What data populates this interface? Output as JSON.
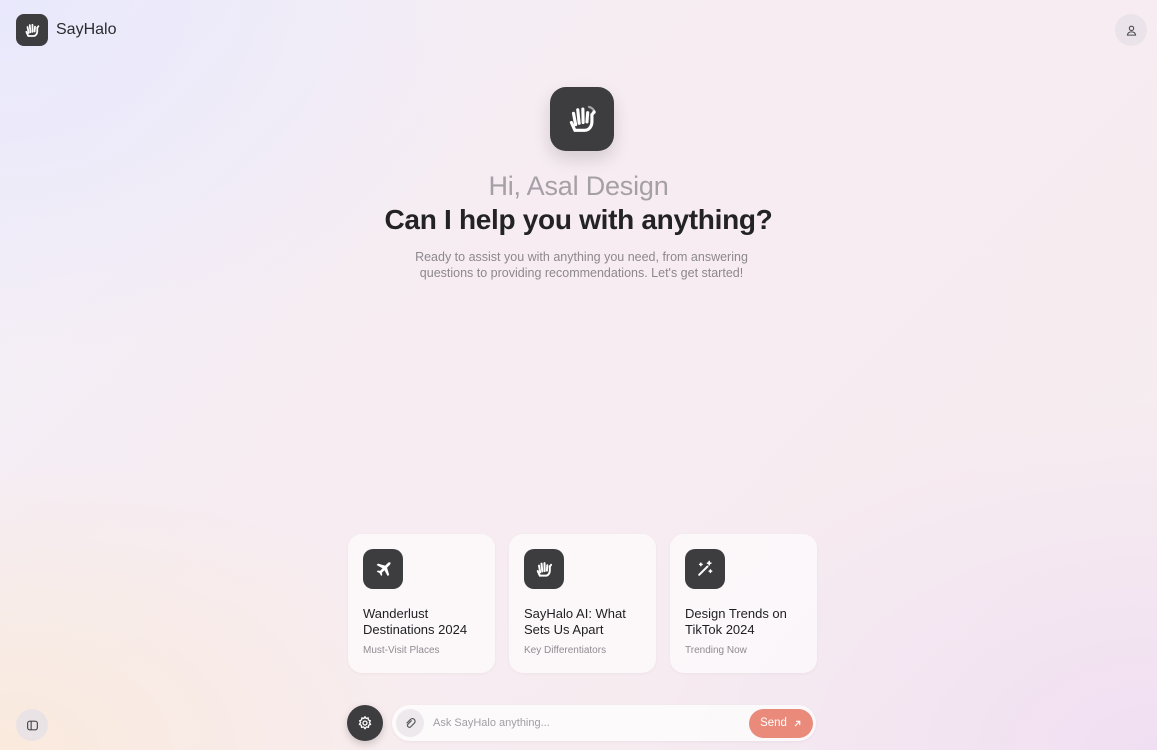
{
  "brand": {
    "name": "SayHalo",
    "logo_icon": "waving-hand-icon"
  },
  "header": {
    "profile_icon": "user-icon"
  },
  "hero": {
    "icon": "waving-hand-icon",
    "greeting": "Hi, Asal Design",
    "headline": "Can I help you with anything?",
    "subtitle": "Ready to assist you with anything you need, from answering questions to providing recommendations. Let's get started!"
  },
  "cards": [
    {
      "icon": "airplane-icon",
      "title": "Wanderlust Destinations 2024",
      "tag": "Must-Visit Places"
    },
    {
      "icon": "waving-hand-icon",
      "title": "SayHalo AI: What Sets Us Apart",
      "tag": "Key Differentiators"
    },
    {
      "icon": "magic-wand-icon",
      "title": "Design Trends on TikTok 2024",
      "tag": "Trending Now"
    }
  ],
  "composer": {
    "placeholder": "Ask SayHalo anything...",
    "value": "",
    "send_label": "Send",
    "attach_icon": "paperclip-icon",
    "settings_icon": "gear-icon",
    "send_icon": "arrow-up-right-icon"
  },
  "footer": {
    "sidebar_icon": "sidebar-toggle-icon"
  },
  "colors": {
    "accent": "#e98a7b",
    "dark_tile": "#3d3d3f",
    "heading": "#232325",
    "greeting": "#a4a0a6",
    "muted": "#8c888e"
  }
}
